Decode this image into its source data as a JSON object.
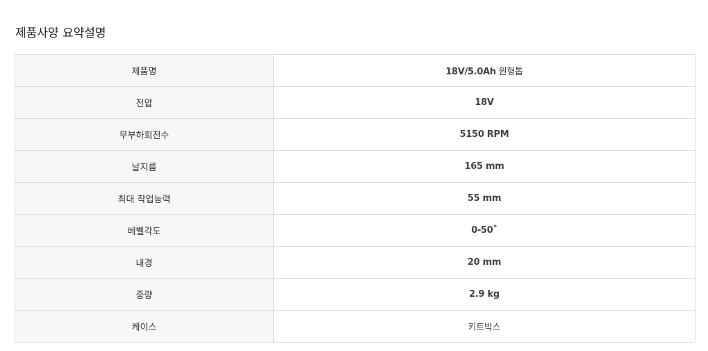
{
  "heading": "제품사양 요약설명",
  "specs": [
    {
      "label": "제품명",
      "value": "18V/5.0Ah",
      "value_suffix": " 원형톱"
    },
    {
      "label": "전압",
      "value": "18V"
    },
    {
      "label": "무부하회전수",
      "value": "5150 RPM"
    },
    {
      "label": "날지름",
      "value": "165 mm"
    },
    {
      "label": "최대 작업능력",
      "value": "55 mm"
    },
    {
      "label": "베벨각도",
      "value": "0-50˚"
    },
    {
      "label": "내경",
      "value": "20 mm"
    },
    {
      "label": "중량",
      "value": "2.9 kg"
    },
    {
      "label": "케이스",
      "value": "키트박스"
    }
  ]
}
